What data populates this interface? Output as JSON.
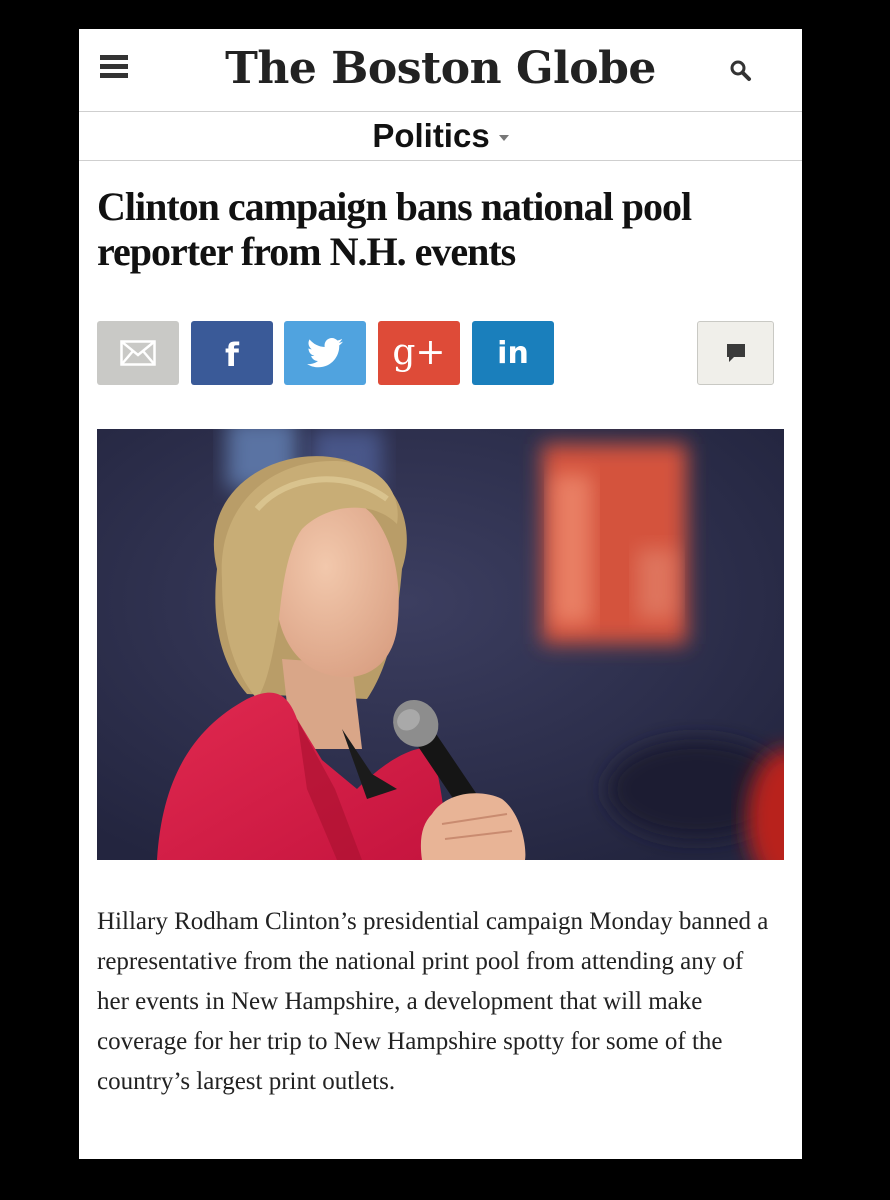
{
  "masthead": {
    "logo": "The Boston Globe"
  },
  "section": {
    "label": "Politics"
  },
  "article": {
    "headline": "Clinton campaign bans national pool reporter from N.H. events",
    "body": "Hillary Rodham Clinton’s presidential campaign Monday banned a representative from the national print pool from attending any of her events in New Hampshire, a development that will make coverage for her trip to New Hampshire spotty for some of the country’s largest print outlets."
  },
  "share": {
    "facebook_glyph": "f",
    "gplus_glyph": "g+",
    "linkedin_glyph": "in"
  },
  "icons": {
    "menu": "menu-icon",
    "search": "search-icon",
    "email": "email-icon",
    "twitter": "twitter-bird-icon",
    "comment": "comment-icon"
  },
  "colors": {
    "email": "#c9c9c6",
    "facebook": "#3a5a98",
    "twitter": "#50a3df",
    "gplus": "#de4b38",
    "linkedin": "#1a7fbc",
    "comments": "#f0efea"
  }
}
